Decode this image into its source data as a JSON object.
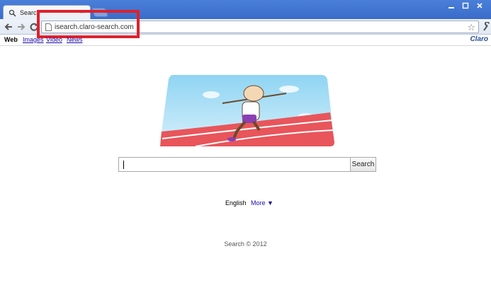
{
  "browser": {
    "tab_title": "Search",
    "url": "isearch.claro-search.com",
    "icons": {
      "favicon": "search-icon",
      "back": "back-arrow-icon",
      "forward": "forward-arrow-icon",
      "reload": "reload-icon",
      "star": "star-icon",
      "wrench": "wrench-icon",
      "minimize": "minimize-icon",
      "maximize": "maximize-icon",
      "close": "close-icon"
    },
    "highlight_color": "#e0202a"
  },
  "nav": {
    "items": [
      "Web",
      "Images",
      "Video",
      "News"
    ],
    "brand": "Claro"
  },
  "search": {
    "value": "",
    "button_label": "Search"
  },
  "lang": {
    "current": "English",
    "more_label": "More ▼"
  },
  "footer": "Search © 2012"
}
